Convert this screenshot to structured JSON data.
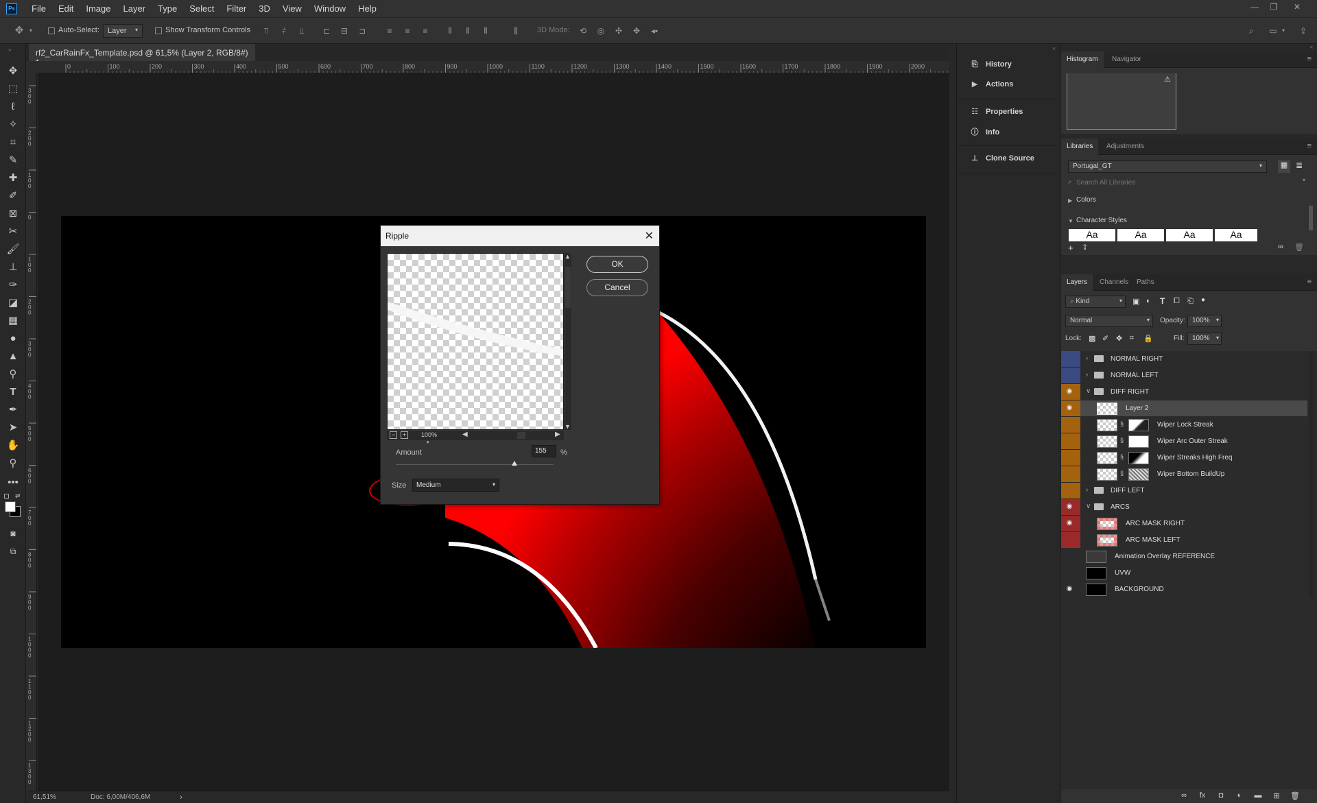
{
  "app": {
    "logo": "Ps"
  },
  "menu": [
    "File",
    "Edit",
    "Image",
    "Layer",
    "Type",
    "Select",
    "Filter",
    "3D",
    "View",
    "Window",
    "Help"
  ],
  "options_bar": {
    "auto_select_label": "Auto-Select:",
    "auto_select_value": "Layer",
    "show_transform_label": "Show Transform Controls",
    "mode_3d_label": "3D Mode:"
  },
  "document": {
    "tab_title": "rf2_CarRainFx_Template.psd @ 61,5% (Layer 2, RGB/8#) *",
    "tab_close": "×",
    "ruler_h_ticks": [
      "0",
      "100",
      "200",
      "300",
      "400",
      "500",
      "600",
      "700",
      "800",
      "900",
      "1000",
      "1100",
      "1200",
      "1300",
      "1400",
      "1500",
      "1600",
      "1700",
      "1800",
      "1900",
      "2000"
    ],
    "ruler_v_ticks": [
      "3\n0\n0",
      "2\n0\n0",
      "1\n0\n0",
      "0",
      "1\n0\n0",
      "2\n0\n0",
      "3\n0\n0",
      "4\n0\n0",
      "5\n0\n0",
      "6\n0\n0",
      "7\n0\n0",
      "8\n0\n0",
      "9\n0\n0",
      "1\n0\n0\n0",
      "1\n1\n0\n0",
      "1\n2\n0\n0",
      "1\n3\n0\n0"
    ],
    "zoom": "61,51%",
    "doc_size": "Doc: 6,00M/406,6M",
    "status_arrow": "›"
  },
  "dock": {
    "history": "History",
    "actions": "Actions",
    "properties": "Properties",
    "info": "Info",
    "clone_source": "Clone Source"
  },
  "histogram_panel": {
    "tabs": [
      "Histogram",
      "Navigator"
    ],
    "warning": "⚠"
  },
  "libraries_panel": {
    "tabs": [
      "Libraries",
      "Adjustments"
    ],
    "library": "Portugal_GT",
    "search_placeholder": "Search All Libraries",
    "colors": "Colors",
    "character_styles": "Character Styles",
    "style_sample": "Aa"
  },
  "layers_panel": {
    "tabs": [
      "Layers",
      "Channels",
      "Paths"
    ],
    "filter_kind": "Kind",
    "blend_mode": "Normal",
    "opacity_label": "Opacity:",
    "opacity": "100%",
    "lock_label": "Lock:",
    "fill_label": "Fill:",
    "fill": "100%",
    "colors": {
      "blue": "#3b4a80",
      "orange": "#a4620f",
      "red": "#9a2a2a"
    },
    "layers": [
      {
        "name": "NORMAL RIGHT",
        "type": "group",
        "visible": false,
        "color": "blue",
        "indent": 0,
        "expanded": false
      },
      {
        "name": "NORMAL LEFT",
        "type": "group",
        "visible": false,
        "color": "blue",
        "indent": 0,
        "expanded": false
      },
      {
        "name": "DIFF RIGHT",
        "type": "group",
        "visible": true,
        "color": "orange",
        "indent": 0,
        "expanded": true
      },
      {
        "name": "Layer 2",
        "type": "layer",
        "visible": true,
        "color": "orange",
        "indent": 1,
        "selected": true
      },
      {
        "name": "Wiper Lock Streak",
        "type": "masked",
        "visible": false,
        "color": "orange",
        "indent": 1
      },
      {
        "name": "Wiper Arc Outer Streak",
        "type": "masked",
        "visible": false,
        "color": "orange",
        "indent": 1
      },
      {
        "name": "Wiper Streaks High Freq",
        "type": "masked",
        "visible": false,
        "color": "orange",
        "indent": 1
      },
      {
        "name": "Wiper Bottom BuildUp",
        "type": "masked",
        "visible": false,
        "color": "orange",
        "indent": 1
      },
      {
        "name": "DIFF LEFT",
        "type": "group",
        "visible": false,
        "color": "orange",
        "indent": 0,
        "expanded": false
      },
      {
        "name": "ARCS",
        "type": "group",
        "visible": true,
        "color": "red",
        "indent": 0,
        "expanded": true
      },
      {
        "name": "ARC MASK RIGHT",
        "type": "red-layer",
        "visible": true,
        "color": "red",
        "indent": 1
      },
      {
        "name": "ARC MASK LEFT",
        "type": "red-layer",
        "visible": false,
        "color": "red",
        "indent": 1
      },
      {
        "name": "Animation Overlay REFERENCE",
        "type": "ref",
        "visible": false,
        "color": "none",
        "indent": 0
      },
      {
        "name": "UVW",
        "type": "black",
        "visible": false,
        "color": "none",
        "indent": 0
      },
      {
        "name": "BACKGROUND",
        "type": "black",
        "visible": true,
        "color": "none",
        "indent": 0
      }
    ],
    "footer_icons": [
      "link-icon",
      "fx-icon",
      "mask-icon",
      "adjustment-icon",
      "group-icon",
      "new-layer-icon",
      "trash-icon"
    ]
  },
  "ripple_dialog": {
    "title": "Ripple",
    "ok": "OK",
    "cancel": "Cancel",
    "preview_zoom": "100%",
    "amount_label": "Amount",
    "amount_value": "155",
    "amount_unit": "%",
    "amount_slider_fraction": 0.75,
    "size_label": "Size",
    "size_value": "Medium"
  }
}
